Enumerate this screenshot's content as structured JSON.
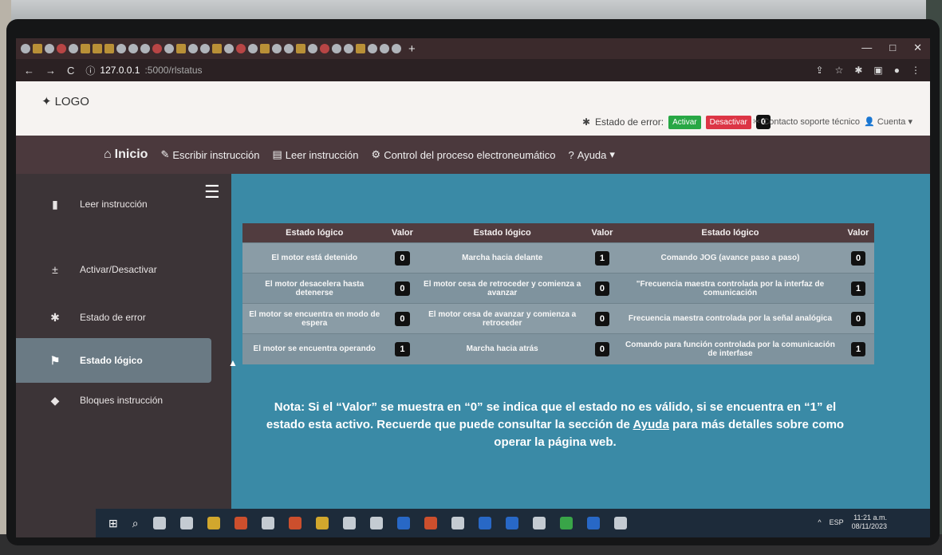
{
  "browser": {
    "url_host": "127.0.0.1",
    "url_path": ":5000/rlstatus"
  },
  "header": {
    "logo_text": "LOGO",
    "error_label": "Estado de error:",
    "activar_label": "Activar",
    "desactivar_label": "Desactivar",
    "error_count": "0",
    "contact_label": "Contacto soporte técnico",
    "account_label": "Cuenta"
  },
  "nav": {
    "home": "Inicio",
    "items": [
      "Escribir instrucción",
      "Leer instrucción",
      "Control del proceso electroneumático",
      "Ayuda"
    ]
  },
  "sidebar": {
    "items": [
      {
        "label": "Leer instrucción",
        "icon": "document-icon"
      },
      {
        "label": "Activar/Desactivar",
        "icon": "plus-minus-icon"
      },
      {
        "label": "Estado de error",
        "icon": "bug-icon"
      },
      {
        "label": "Estado lógico",
        "icon": "flag-icon",
        "active": true
      },
      {
        "label": "Bloques instrucción",
        "icon": "cube-icon"
      }
    ]
  },
  "table": {
    "headers": [
      "Estado lógico",
      "Valor",
      "Estado lógico",
      "Valor",
      "Estado lógico",
      "Valor"
    ],
    "rows": [
      [
        "El motor está detenido",
        "0",
        "Marcha hacia delante",
        "1",
        "Comando JOG (avance paso a paso)",
        "0"
      ],
      [
        "El motor desacelera hasta detenerse",
        "0",
        "El motor cesa de retroceder y comienza a avanzar",
        "0",
        "\"Frecuencia maestra controlada por la interfaz de comunicación",
        "1"
      ],
      [
        "El motor se encuentra en modo de espera",
        "0",
        "El motor cesa de avanzar y comienza a retroceder",
        "0",
        "Frecuencia maestra controlada por la señal analógica",
        "0"
      ],
      [
        "El motor se encuentra operando",
        "1",
        "Marcha hacia atrás",
        "0",
        "Comando para función controlada por la comunicación de interfase",
        "1"
      ]
    ]
  },
  "nota": {
    "before": "Nota: Si el “Valor” se muestra en “0” se indica que el estado no es válido, si se encuentra en “1” el estado esta activo. Recuerde que puede consultar la sección de ",
    "link": "Ayuda",
    "after": " para más detalles sobre como operar la página web."
  },
  "taskbar": {
    "lang": "ESP",
    "time": "11:21 a.m.",
    "date": "08/11/2023"
  },
  "colors": {
    "navbar": "#4b393d",
    "sidebar": "#3c3437",
    "content_bg": "#3a8aa6",
    "success": "#28a745",
    "danger": "#dc3545"
  }
}
